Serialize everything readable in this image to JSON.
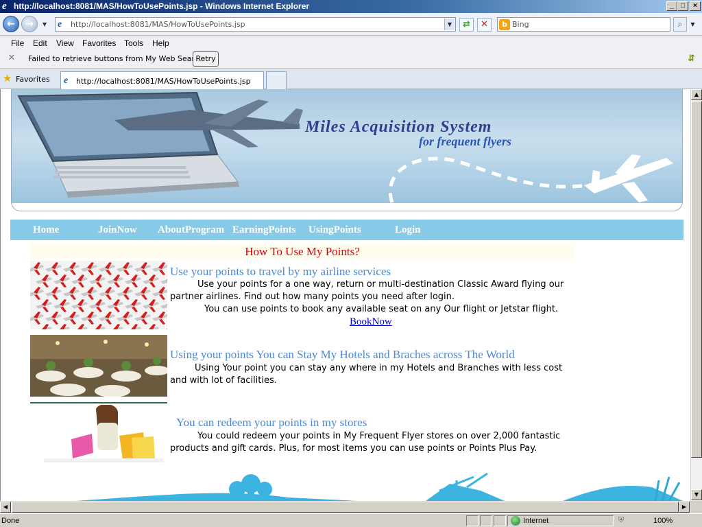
{
  "window": {
    "title": "http://localhost:8081/MAS/HowToUsePoints.jsp - Windows Internet Explorer",
    "controls": {
      "minimize": "_",
      "maximize": "□",
      "close": "×"
    }
  },
  "toolbar": {
    "address_value": "http://localhost:8081/MAS/HowToUsePoints.jsp",
    "search_value": "Bing"
  },
  "menu": {
    "items": [
      "File",
      "Edit",
      "View",
      "Favorites",
      "Tools",
      "Help"
    ]
  },
  "notification": {
    "text": "Failed to retrieve buttons from My Web Search.",
    "retry_label": "Retry"
  },
  "favorites_bar": {
    "label": "Favorites",
    "tab_title": "http://localhost:8081/MAS/HowToUsePoints.jsp"
  },
  "banner": {
    "title": "Miles Acquisition System",
    "subtitle": "for frequent flyers"
  },
  "site_nav": {
    "items": [
      "Home",
      "JoinNow",
      "AboutProgram",
      "EarningPoints",
      "UsingPoints",
      "Login"
    ]
  },
  "page": {
    "heading": "How To Use My Points?",
    "sections": [
      {
        "title": "Use your points to travel by my airline services",
        "body_1": "Use your points for a one way, return or multi-destination Classic Award flying our partner airlines. Find out how many points you need after login.",
        "body_2": "You can use points to book any available seat on any Our flight or Jetstar flight.",
        "link": "BookNow"
      },
      {
        "title": "Using your points You can Stay My Hotels and Braches across The World",
        "body_1": "Using Your point you can stay any where in my Hotels and Branches with less cost and with lot of facilities."
      },
      {
        "title": "You can redeem your  points in my stores",
        "body_1": "You could redeem your points in My Frequent Flyer stores on over 2,000 fantastic products and gift cards. Plus, for most items you can use points or Points Plus Pay."
      }
    ]
  },
  "statusbar": {
    "status": "Done",
    "zone": "Internet",
    "zoom": "100%"
  },
  "colors": {
    "nav_bg": "#87cbe8",
    "heading": "#e00000",
    "section_title": "#4a8ad6",
    "link": "#0000cc"
  }
}
